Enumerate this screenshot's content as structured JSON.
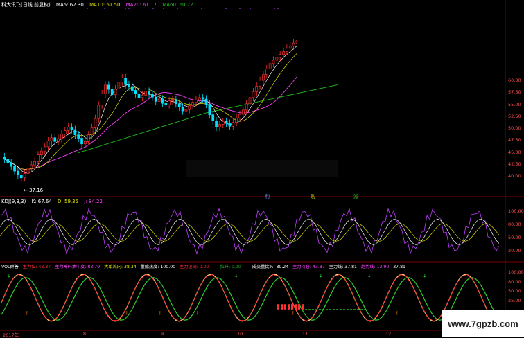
{
  "main_header": {
    "title": "科大讯飞(日线,前复权)",
    "ma5": "MA5: 62.30",
    "ma10": "MA10: 61.50",
    "ma20": "MA20: 61.17",
    "ma60": "MA60: 60.72"
  },
  "price_axis": [
    "60.00",
    "57.50",
    "55.00",
    "52.50",
    "50.00",
    "47.50",
    "45.00",
    "42.50",
    "40.00"
  ],
  "low_marker": "37.16",
  "event_marks": [
    "利",
    "购",
    "減"
  ],
  "kdj_header": {
    "label": "KDJ(9,3,3)",
    "k": "K: 67.64",
    "d": "D: 59.35",
    "j": "J: 84.22"
  },
  "kdj_axis": [
    "100.00",
    "80.00",
    "50.00",
    "20.00"
  ],
  "vol_header": {
    "name": "VOL群善",
    "f1": "主力位: 43.87",
    "f2": "主力筹码集中度: 83.79",
    "f3": "大单流向: 38.34",
    "f4": "量能热度: 100.00",
    "f5": "主力追随: 0.00",
    "f6": "拉升: 0.00",
    "f7": "成交量比%: 89.24",
    "f8": "主力持仓: 43.87",
    "f9": "主力线: 37.81",
    "f10": "趋势线: 13.90",
    "f11": "37.81"
  },
  "vol_axis": [
    "100.00",
    "80.00",
    "50.00",
    "25.00"
  ],
  "date_axis": [
    "2017年",
    "8",
    "9",
    "10",
    "11",
    "12"
  ],
  "watermark": "www.7gpzb.com",
  "colors": {
    "up": "#ff3030",
    "down": "#00e0ff",
    "ma5": "#ffffff",
    "ma10": "#e0e000",
    "ma20": "#ff40ff",
    "ma60": "#20c020",
    "kdj_k": "#ffffff",
    "kdj_d": "#e0e000",
    "kdj_j": "#c040ff",
    "header_yellow": "#e0e000",
    "header_pink": "#ff40ff",
    "header_red": "#ff3030",
    "header_white": "#ffffff"
  }
}
